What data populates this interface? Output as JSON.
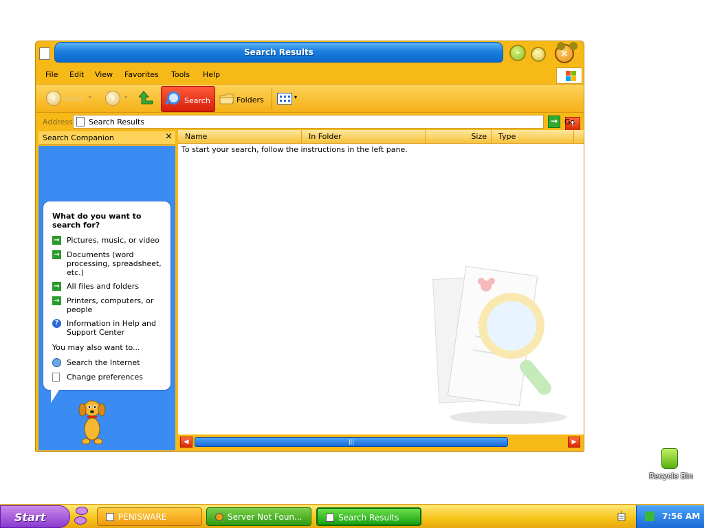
{
  "window": {
    "title": "Search Results",
    "menu": [
      "File",
      "Edit",
      "View",
      "Favorites",
      "Tools",
      "Help"
    ],
    "toolbar": {
      "back_label": "Back",
      "search_label": "Search",
      "folders_label": "Folders"
    },
    "address": {
      "label": "Address",
      "value": "Search Results",
      "go_label": "Go"
    }
  },
  "search_companion": {
    "title": "Search Companion",
    "close_glyph": "×",
    "heading": "What do you want to search for?",
    "options": [
      "Pictures, music, or video",
      "Documents (word processing, spreadsheet, etc.)",
      "All files and folders",
      "Printers, computers, or people",
      "Information in Help and Support Center"
    ],
    "also_heading": "You may also want to...",
    "also_options": [
      "Search the Internet",
      "Change preferences"
    ]
  },
  "results": {
    "columns": [
      "Name",
      "In Folder",
      "Size",
      "Type"
    ],
    "empty_message": "To start your search, follow the instructions in the left pane."
  },
  "taskbar": {
    "start_label": "Start",
    "tasks": [
      "PENISWARE",
      "Server Not Foun...",
      "Search Results"
    ],
    "clock": "7:56 AM"
  },
  "desktop": {
    "recycle_bin_label": "Recycle Bin"
  },
  "colors": {
    "frame": "#f7b918",
    "title_blue": "#1a7fe0",
    "pane_blue": "#3b8cf2",
    "search_red": "#d81e0a",
    "start_purple": "#8a3ad0"
  }
}
